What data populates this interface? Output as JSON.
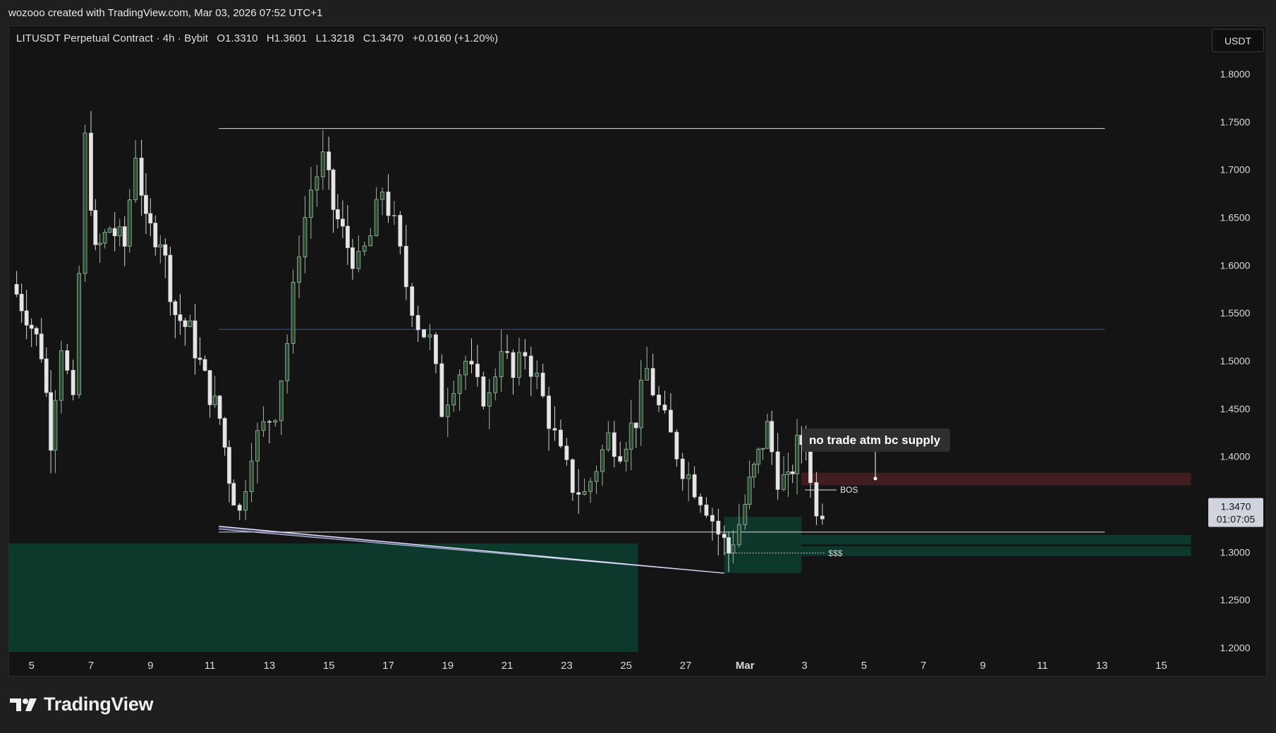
{
  "header": {
    "credit": "wozooo created with TradingView.com, Mar 03, 2026 07:52 UTC+1"
  },
  "legend": {
    "symbol": "LITUSDT Perpetual Contract · 4h · Bybit",
    "open": "O1.3310",
    "high": "H1.3601",
    "low": "L1.3218",
    "close": "C1.3470",
    "change": "+0.0160 (+1.20%)"
  },
  "currency_button": "USDT",
  "branding": {
    "logo_text": "TradingView"
  },
  "colors": {
    "background": "#141414",
    "candle_up": "#9fb8a0",
    "candle_down": "#d6d6d6",
    "demand_zone": "#0d3b2e",
    "supply_zone": "#4a1f22",
    "horizontal_line": "#e0e0e0",
    "blue_line": "#2a5bb8",
    "price_label_bg": "#d1d4dc"
  },
  "chart_data": {
    "type": "candlestick",
    "title": "",
    "symbol": "LITUSDT Perpetual Contract",
    "timeframe": "4h",
    "exchange": "Bybit",
    "ylim": [
      1.19,
      1.84
    ],
    "y_ticks": [
      "1.8000",
      "1.7500",
      "1.7000",
      "1.6500",
      "1.6000",
      "1.5500",
      "1.5000",
      "1.4500",
      "1.4000",
      "1.3000",
      "1.2500",
      "1.2000"
    ],
    "x_ticks": [
      "5",
      "7",
      "9",
      "11",
      "13",
      "15",
      "17",
      "19",
      "21",
      "23",
      "25",
      "27",
      "Mar",
      "3",
      "5",
      "7",
      "9",
      "11",
      "13",
      "15"
    ],
    "x_tick_days": [
      5,
      7,
      9,
      11,
      13,
      15,
      17,
      19,
      21,
      23,
      25,
      27,
      29,
      31,
      33,
      35,
      37,
      39,
      41,
      43
    ],
    "x_axis_note": "day index: 5 = Feb 5; 29 = Mar 1; 31 = Mar 3",
    "current_price": "1.3470",
    "countdown": "01:07:05",
    "price_path": [
      [
        4.5,
        1.58
      ],
      [
        5.0,
        1.55
      ],
      [
        5.5,
        1.51
      ],
      [
        5.8,
        1.42
      ],
      [
        6.2,
        1.52
      ],
      [
        6.6,
        1.45
      ],
      [
        7.0,
        1.73
      ],
      [
        7.3,
        1.61
      ],
      [
        7.8,
        1.64
      ],
      [
        8.3,
        1.62
      ],
      [
        8.7,
        1.72
      ],
      [
        9.0,
        1.64
      ],
      [
        9.5,
        1.63
      ],
      [
        10.0,
        1.55
      ],
      [
        10.5,
        1.53
      ],
      [
        11.0,
        1.48
      ],
      [
        11.5,
        1.44
      ],
      [
        11.8,
        1.38
      ],
      [
        12.2,
        1.34
      ],
      [
        12.6,
        1.41
      ],
      [
        13.0,
        1.43
      ],
      [
        13.4,
        1.45
      ],
      [
        13.8,
        1.52
      ],
      [
        14.2,
        1.62
      ],
      [
        14.6,
        1.68
      ],
      [
        15.0,
        1.71
      ],
      [
        15.3,
        1.66
      ],
      [
        15.8,
        1.62
      ],
      [
        16.2,
        1.6
      ],
      [
        16.6,
        1.63
      ],
      [
        17.0,
        1.68
      ],
      [
        17.4,
        1.64
      ],
      [
        17.8,
        1.58
      ],
      [
        18.2,
        1.54
      ],
      [
        18.6,
        1.52
      ],
      [
        19.0,
        1.45
      ],
      [
        19.4,
        1.48
      ],
      [
        19.8,
        1.5
      ],
      [
        20.2,
        1.47
      ],
      [
        20.6,
        1.46
      ],
      [
        21.0,
        1.52
      ],
      [
        21.4,
        1.48
      ],
      [
        21.8,
        1.51
      ],
      [
        22.2,
        1.48
      ],
      [
        22.6,
        1.44
      ],
      [
        23.0,
        1.4
      ],
      [
        23.4,
        1.37
      ],
      [
        23.8,
        1.36
      ],
      [
        24.2,
        1.39
      ],
      [
        24.6,
        1.42
      ],
      [
        25.0,
        1.41
      ],
      [
        25.5,
        1.44
      ],
      [
        25.9,
        1.49
      ],
      [
        26.3,
        1.45
      ],
      [
        26.7,
        1.42
      ],
      [
        27.1,
        1.39
      ],
      [
        27.5,
        1.37
      ],
      [
        27.9,
        1.35
      ],
      [
        28.3,
        1.32
      ],
      [
        28.6,
        1.3
      ],
      [
        29.0,
        1.33
      ],
      [
        29.3,
        1.37
      ],
      [
        29.6,
        1.4
      ],
      [
        29.9,
        1.43
      ],
      [
        30.3,
        1.38
      ],
      [
        30.6,
        1.37
      ],
      [
        30.9,
        1.41
      ],
      [
        31.2,
        1.42
      ],
      [
        31.4,
        1.37
      ],
      [
        31.6,
        1.35
      ],
      [
        31.8,
        1.347
      ]
    ],
    "annotations": [
      {
        "type": "hline",
        "label": "range-high",
        "y": 1.743,
        "x_start": 11.3,
        "x_end": 41.1
      },
      {
        "type": "hline",
        "label": "mid-line",
        "y": 1.533,
        "x_start": 11.3,
        "x_end": 41.1
      },
      {
        "type": "hline",
        "label": "range-low",
        "y": 1.321,
        "x_start": 11.3,
        "x_end": 41.1
      },
      {
        "type": "trendline",
        "from": [
          11.3,
          1.327
        ],
        "to": [
          28.3,
          1.278
        ]
      },
      {
        "type": "zone",
        "label": "demand-zone",
        "y_top": 1.309,
        "y_bottom": 1.19,
        "x_start": 4.0,
        "x_end": 25.4
      },
      {
        "type": "zone",
        "label": "demand-zone-small",
        "y_top": 1.337,
        "y_bottom": 1.278,
        "x_start": 28.3,
        "x_end": 30.9
      },
      {
        "type": "zone",
        "label": "demand-strip",
        "y_top": 1.318,
        "y_bottom": 1.308,
        "x_start": 30.9,
        "x_end": 44.0
      },
      {
        "type": "zone",
        "label": "demand-strip-2",
        "y_top": 1.306,
        "y_bottom": 1.296,
        "x_start": 30.9,
        "x_end": 44.0
      },
      {
        "type": "zone",
        "label": "supply-zone",
        "y_top": 1.383,
        "y_bottom": 1.37,
        "x_start": 30.9,
        "x_end": 44.0
      },
      {
        "type": "label",
        "text": "BOS",
        "at": [
          32.2,
          1.365
        ]
      },
      {
        "type": "label",
        "text": "$$$",
        "at": [
          31.8,
          1.296
        ]
      },
      {
        "type": "callout",
        "text": "no trade atm bc supply",
        "at": [
          33.6,
          1.377
        ]
      }
    ]
  }
}
